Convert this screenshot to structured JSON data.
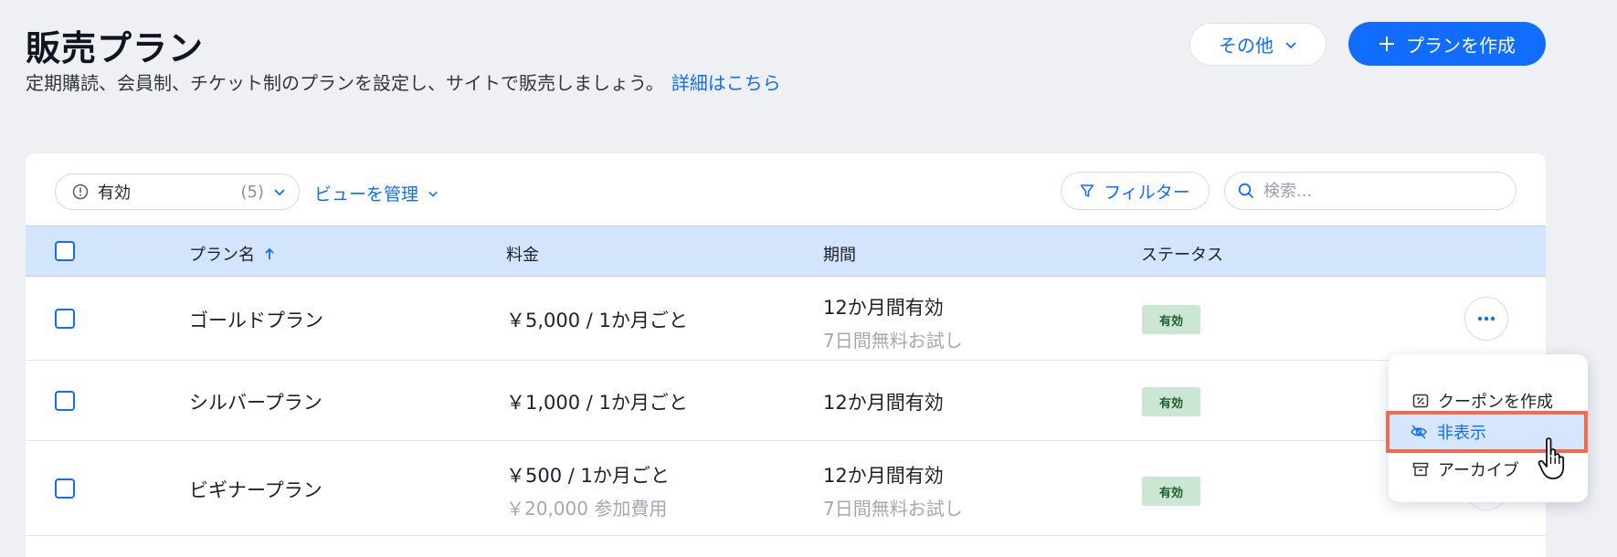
{
  "header": {
    "title": "販売プラン",
    "subtitle": "定期購読、会員制、チケット制のプランを設定し、サイトで販売しましょう。",
    "learn_more": "詳細はこちら",
    "more_button": "その他",
    "create_button": "プランを作成"
  },
  "toolbar": {
    "view_label": "有効",
    "view_count": "(5)",
    "manage_views": "ビューを管理",
    "filter": "フィルター",
    "search_placeholder": "検索..."
  },
  "table": {
    "columns": {
      "name": "プラン名",
      "price": "料金",
      "duration": "期間",
      "status": "ステータス"
    },
    "rows": [
      {
        "name": "ゴールドプラン",
        "price": "￥5,000 / 1か月ごと",
        "price_sub": "",
        "duration": "12か月間有効",
        "duration_sub": "7日間無料お試し",
        "status": "有効"
      },
      {
        "name": "シルバープラン",
        "price": "￥1,000 / 1か月ごと",
        "price_sub": "",
        "duration": "12か月間有効",
        "duration_sub": "",
        "status": "有効"
      },
      {
        "name": "ビギナープラン",
        "price": "￥500 / 1か月ごと",
        "price_sub": "￥20,000 参加費用",
        "duration": "12か月間有効",
        "duration_sub": "7日間無料お試し",
        "status": "有効"
      }
    ]
  },
  "row_menu": {
    "items": [
      {
        "label": "クーポンを作成",
        "icon": "coupon-icon"
      },
      {
        "label": "非表示",
        "icon": "eye-off-icon",
        "highlighted": true
      },
      {
        "label": "アーカイブ",
        "icon": "archive-icon"
      }
    ]
  },
  "colors": {
    "accent": "#116dff",
    "header_bg": "#d3e4fd",
    "badge_bg": "#cbe6d3",
    "highlight_border": "#ef6a4f"
  }
}
